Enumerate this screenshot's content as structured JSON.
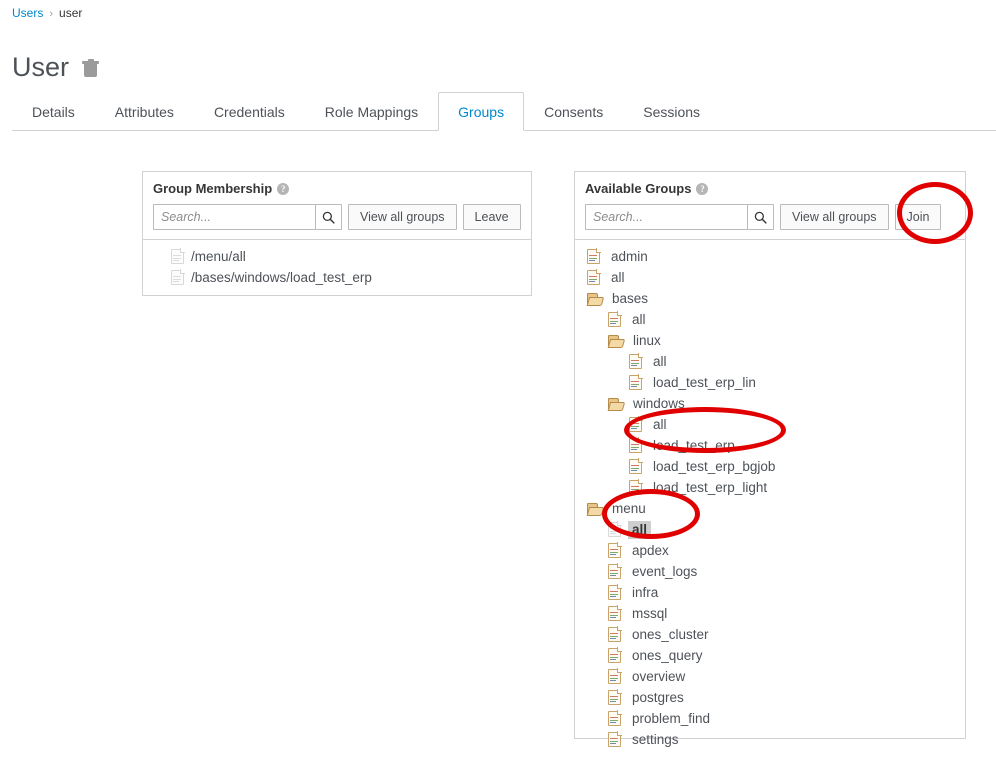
{
  "breadcrumb": {
    "root": "Users",
    "separator": "›",
    "current": "user"
  },
  "page": {
    "title": "User",
    "delete_icon": "trash-icon"
  },
  "tabs": [
    {
      "label": "Details",
      "active": false
    },
    {
      "label": "Attributes",
      "active": false
    },
    {
      "label": "Credentials",
      "active": false
    },
    {
      "label": "Role Mappings",
      "active": false
    },
    {
      "label": "Groups",
      "active": true
    },
    {
      "label": "Consents",
      "active": false
    },
    {
      "label": "Sessions",
      "active": false
    }
  ],
  "membership_panel": {
    "title": "Group Membership",
    "help_glyph": "?",
    "search_placeholder": "Search...",
    "search_value": "",
    "search_icon": "search-icon",
    "view_all_label": "View all groups",
    "action_label": "Leave",
    "items": [
      {
        "path": "/menu/all"
      },
      {
        "path": "/bases/windows/load_test_erp"
      }
    ]
  },
  "available_panel": {
    "title": "Available Groups",
    "help_glyph": "?",
    "search_placeholder": "Search...",
    "search_value": "",
    "search_icon": "search-icon",
    "view_all_label": "View all groups",
    "action_label": "Join",
    "tree": [
      {
        "label": "admin",
        "depth": 0,
        "type": "file",
        "selected": false
      },
      {
        "label": "all",
        "depth": 0,
        "type": "file",
        "selected": false
      },
      {
        "label": "bases",
        "depth": 0,
        "type": "folder",
        "selected": false
      },
      {
        "label": "all",
        "depth": 1,
        "type": "file",
        "selected": false
      },
      {
        "label": "linux",
        "depth": 1,
        "type": "folder",
        "selected": false
      },
      {
        "label": "all",
        "depth": 2,
        "type": "file",
        "selected": false
      },
      {
        "label": "load_test_erp_lin",
        "depth": 2,
        "type": "file",
        "selected": false
      },
      {
        "label": "windows",
        "depth": 1,
        "type": "folder",
        "selected": false
      },
      {
        "label": "all",
        "depth": 2,
        "type": "file",
        "selected": false
      },
      {
        "label": "load_test_erp",
        "depth": 2,
        "type": "file",
        "selected": false
      },
      {
        "label": "load_test_erp_bgjob",
        "depth": 2,
        "type": "file",
        "selected": false
      },
      {
        "label": "load_test_erp_light",
        "depth": 2,
        "type": "file",
        "selected": false
      },
      {
        "label": "menu",
        "depth": 0,
        "type": "folder",
        "selected": false
      },
      {
        "label": "all",
        "depth": 1,
        "type": "file",
        "selected": true
      },
      {
        "label": "apdex",
        "depth": 1,
        "type": "file",
        "selected": false
      },
      {
        "label": "event_logs",
        "depth": 1,
        "type": "file",
        "selected": false
      },
      {
        "label": "infra",
        "depth": 1,
        "type": "file",
        "selected": false
      },
      {
        "label": "mssql",
        "depth": 1,
        "type": "file",
        "selected": false
      },
      {
        "label": "ones_cluster",
        "depth": 1,
        "type": "file",
        "selected": false
      },
      {
        "label": "ones_query",
        "depth": 1,
        "type": "file",
        "selected": false
      },
      {
        "label": "overview",
        "depth": 1,
        "type": "file",
        "selected": false
      },
      {
        "label": "postgres",
        "depth": 1,
        "type": "file",
        "selected": false
      },
      {
        "label": "problem_find",
        "depth": 1,
        "type": "file",
        "selected": false
      },
      {
        "label": "settings",
        "depth": 1,
        "type": "file",
        "selected": false
      }
    ]
  },
  "annotations": {
    "color": "#e00000",
    "shapes": [
      {
        "name": "join-button-highlight",
        "target": "Join"
      },
      {
        "name": "load-test-erp-highlight",
        "target": "load_test_erp"
      },
      {
        "name": "menu-all-highlight",
        "target": "all"
      }
    ]
  }
}
